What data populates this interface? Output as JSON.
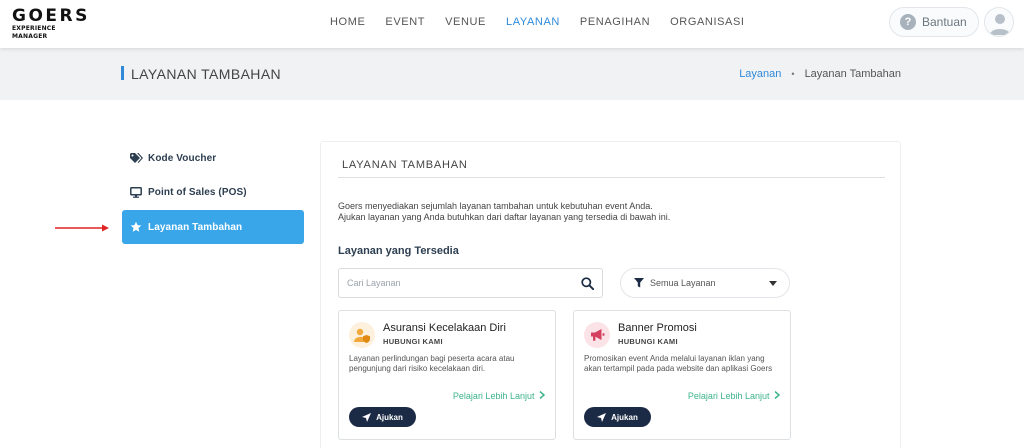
{
  "header": {
    "logo_brand": "GOERS",
    "logo_sub": "EXPERIENCE MANAGER",
    "nav": [
      {
        "label": "HOME"
      },
      {
        "label": "EVENT"
      },
      {
        "label": "VENUE"
      },
      {
        "label": "LAYANAN",
        "active": true
      },
      {
        "label": "PENAGIHAN"
      },
      {
        "label": "ORGANISASI"
      }
    ],
    "help_label": "Bantuan",
    "help_icon": "question-circle-icon",
    "avatar_icon": "user-icon",
    "accent_color": "#2f8ad8"
  },
  "title_band": {
    "page_title": "LAYANAN TAMBAHAN",
    "breadcrumb": {
      "link": "Layanan",
      "separator": "•",
      "current": "Layanan Tambahan"
    }
  },
  "sidebar": {
    "items": [
      {
        "label": "Kode Voucher",
        "icon": "tags-icon"
      },
      {
        "label": "Point of Sales (POS)",
        "icon": "monitor-icon"
      },
      {
        "label": "Layanan Tambahan",
        "icon": "star-icon",
        "active": true
      }
    ],
    "active_color": "#3aa6ea"
  },
  "main": {
    "card_title": "LAYANAN TAMBAHAN",
    "intro_line1": "Goers menyediakan sejumlah layanan tambahan untuk kebutuhan event Anda.",
    "intro_line2": "Ajukan layanan yang Anda butuhkan dari daftar layanan yang tersedia di bawah ini.",
    "section_heading": "Layanan yang Tersedia",
    "search": {
      "placeholder": "Cari Layanan",
      "value": ""
    },
    "filter": {
      "selected": "Semua Layanan"
    },
    "services": [
      {
        "name": "Asuransi Kecelakaan Diri",
        "contact": "HUBUNGI KAMI",
        "description": "Layanan perlindungan bagi peserta acara atau pengunjung dari risiko kecelakaan diri.",
        "more": "Pelajari Lebih Lanjut",
        "button": "Ajukan",
        "icon": "user-shield-icon",
        "icon_color": "#f2a93b"
      },
      {
        "name": "Banner Promosi",
        "contact": "HUBUNGI KAMI",
        "description": "Promosikan event Anda melalui layanan iklan yang akan tertampil pada pada website dan aplikasi Goers",
        "more": "Pelajari Lebih Lanjut",
        "button": "Ajukan",
        "icon": "megaphone-icon",
        "icon_color": "#d6405f"
      }
    ]
  }
}
